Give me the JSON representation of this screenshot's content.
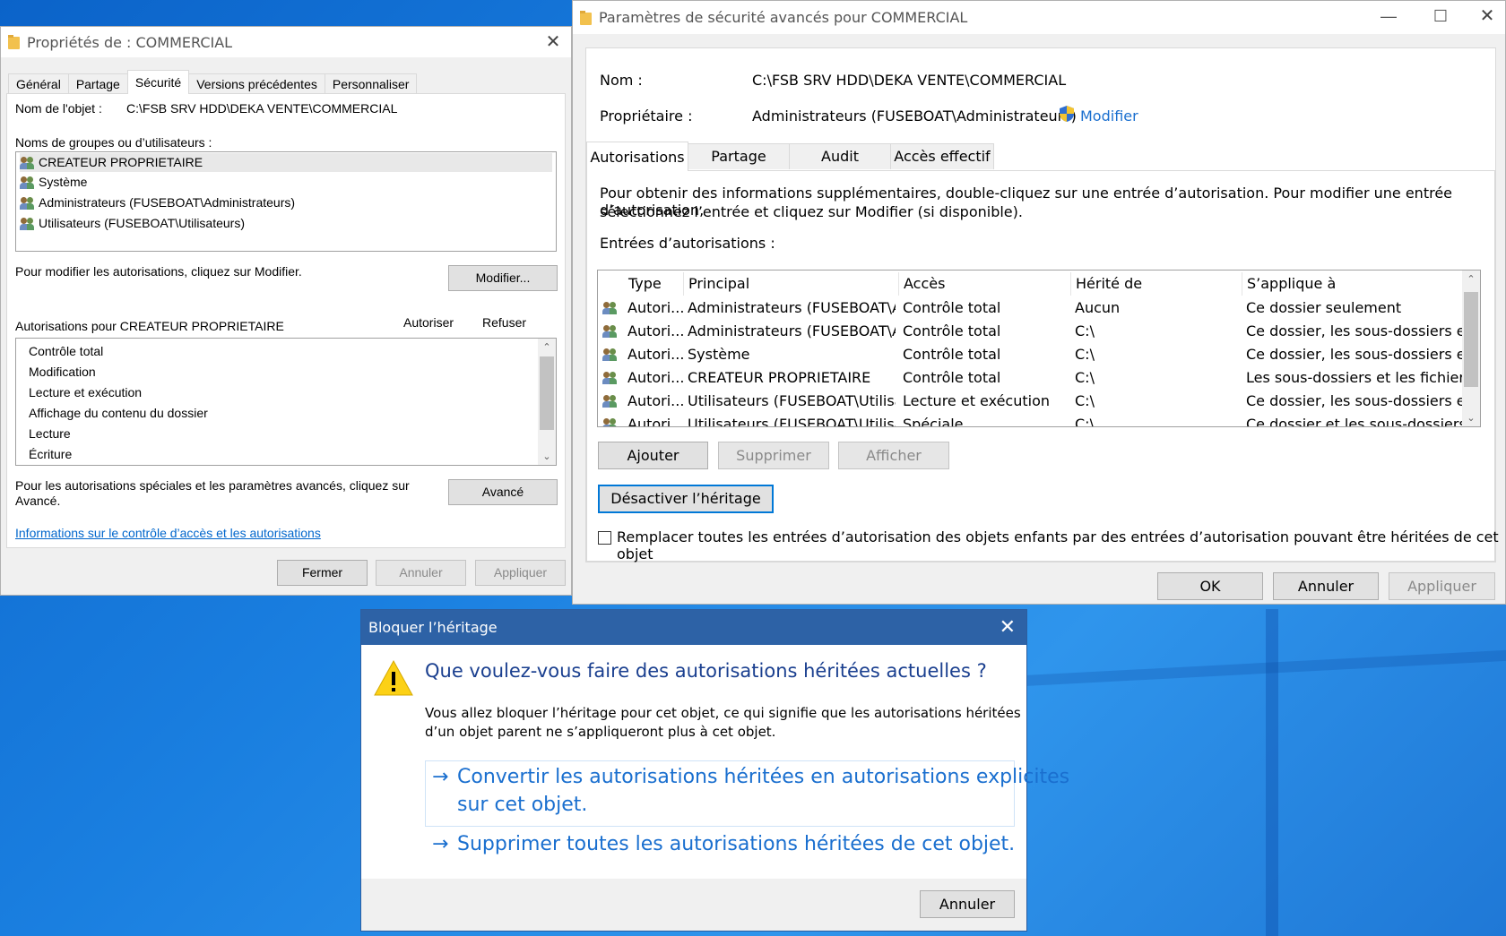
{
  "props": {
    "title": "Propriétés de : COMMERCIAL",
    "tabs": [
      "Général",
      "Partage",
      "Sécurité",
      "Versions précédentes",
      "Personnaliser"
    ],
    "object_label": "Nom de l'objet :",
    "object_value": "C:\\FSB SRV HDD\\DEKA VENTE\\COMMERCIAL",
    "groups_label": "Noms de groupes ou d’utilisateurs :",
    "users": [
      "CREATEUR PROPRIETAIRE",
      "Système",
      "Administrateurs (FUSEBOAT\\Administrateurs)",
      "Utilisateurs (FUSEBOAT\\Utilisateurs)"
    ],
    "modify_hint": "Pour modifier les autorisations, cliquez sur Modifier.",
    "modify_button": "Modifier...",
    "perms_for": "Autorisations pour CREATEUR PROPRIETAIRE",
    "allow_header": "Autoriser",
    "deny_header": "Refuser",
    "permissions": [
      "Contrôle total",
      "Modification",
      "Lecture et exécution",
      "Affichage du contenu du dossier",
      "Lecture",
      "Écriture"
    ],
    "advanced_hint_1": "Pour les autorisations spéciales et les paramètres avancés, cliquez sur",
    "advanced_hint_2": "Avancé.",
    "advanced_button": "Avancé",
    "info_link": "Informations sur le contrôle d’accès et les autorisations",
    "close_button": "Fermer",
    "cancel_button": "Annuler",
    "apply_button": "Appliquer"
  },
  "adv": {
    "title": "Paramètres de sécurité avancés pour COMMERCIAL",
    "name_label": "Nom :",
    "name_value": "C:\\FSB SRV HDD\\DEKA VENTE\\COMMERCIAL",
    "owner_label": "Propriétaire :",
    "owner_value": "Administrateurs (FUSEBOAT\\Administrateurs)",
    "owner_modify": "Modifier",
    "tabs": [
      "Autorisations",
      "Partage",
      "Audit",
      "Accès effectif"
    ],
    "info_1": "Pour obtenir des informations supplémentaires, double-cliquez sur une entrée d’autorisation. Pour modifier une entrée d’autorisation,",
    "info_2": "sélectionnez l’entrée et cliquez sur Modifier (si disponible).",
    "entries_label": "Entrées d’autorisations :",
    "columns": [
      "Type",
      "Principal",
      "Accès",
      "Hérité de",
      "S’applique à"
    ],
    "rows": [
      [
        "Autori...",
        "Administrateurs (FUSEBOAT\\A...",
        "Contrôle total",
        "Aucun",
        "Ce dossier seulement"
      ],
      [
        "Autori...",
        "Administrateurs (FUSEBOAT\\A...",
        "Contrôle total",
        "C:\\",
        "Ce dossier, les sous-dossiers e..."
      ],
      [
        "Autori...",
        "Système",
        "Contrôle total",
        "C:\\",
        "Ce dossier, les sous-dossiers e..."
      ],
      [
        "Autori...",
        "CREATEUR PROPRIETAIRE",
        "Contrôle total",
        "C:\\",
        "Les sous-dossiers et les fichier..."
      ],
      [
        "Autori...",
        "Utilisateurs (FUSEBOAT\\Utilisat...",
        "Lecture et exécution",
        "C:\\",
        "Ce dossier, les sous-dossiers e..."
      ],
      [
        "Autori...",
        "Utilisateurs (FUSEBOAT\\Utilisat...",
        "Spéciale",
        "C:\\",
        "Ce dossier et les sous-dossiers"
      ]
    ],
    "add_button": "Ajouter",
    "remove_button": "Supprimer",
    "view_button": "Afficher",
    "disable_inheritance_button": "Désactiver l’héritage",
    "replace_checkbox": "Remplacer toutes les entrées d’autorisation des objets enfants par des entrées d’autorisation pouvant être héritées de cet objet",
    "ok_button": "OK",
    "cancel_button": "Annuler",
    "apply_button": "Appliquer"
  },
  "dialog": {
    "title": "Bloquer l’héritage",
    "question": "Que voulez-vous faire des autorisations héritées actuelles ?",
    "body_1": "Vous allez bloquer l’héritage pour cet objet, ce qui signifie que les autorisations héritées",
    "body_2": "d’un objet parent ne s’appliqueront plus à cet objet.",
    "option_convert_1": "Convertir les autorisations héritées en autorisations explicites",
    "option_convert_2": "sur cet objet.",
    "option_remove": "Supprimer toutes les autorisations héritées de cet objet.",
    "cancel_button": "Annuler",
    "arrow_glyph": "→"
  },
  "colors": {
    "link": "#0066cc",
    "dialog_title": "#2d62a6",
    "dialog_heading": "#1a3f8f",
    "command_link": "#1a6fcf"
  }
}
